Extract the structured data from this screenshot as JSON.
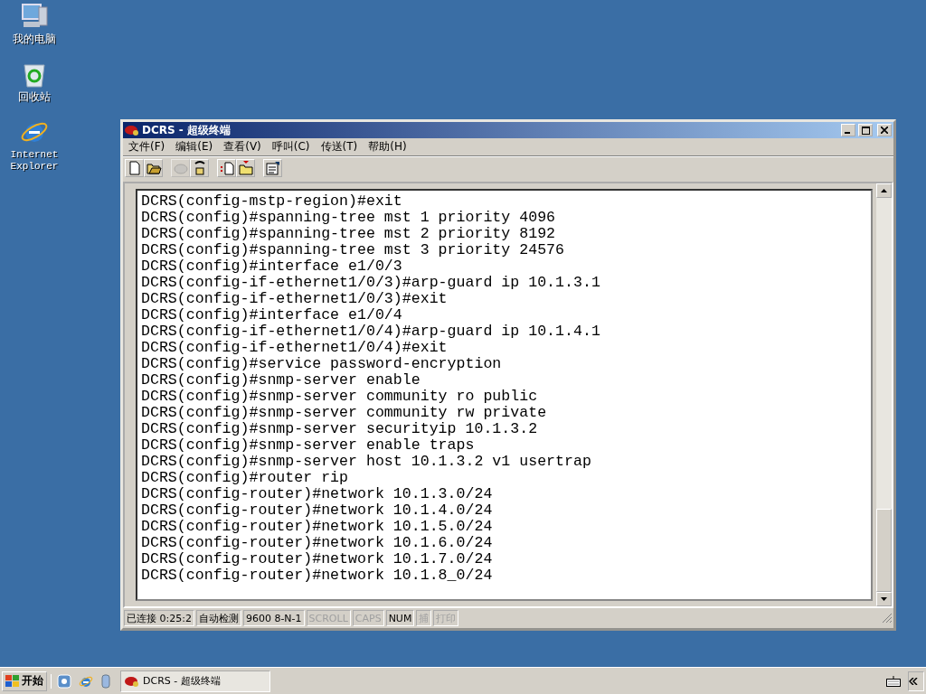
{
  "desktop_icons": [
    {
      "kind": "computer",
      "label": "我的电脑"
    },
    {
      "kind": "recycle",
      "label": "回收站"
    },
    {
      "kind": "browser",
      "label": "Internet Explorer"
    }
  ],
  "window": {
    "title": "DCRS - 超级终端",
    "active": true,
    "menu": [
      "文件(F)",
      "编辑(E)",
      "查看(V)",
      "呼叫(C)",
      "传送(T)",
      "帮助(H)"
    ],
    "toolbar": [
      {
        "kind": "new",
        "disabled": false
      },
      {
        "kind": "open",
        "disabled": false
      },
      {
        "kind": "call",
        "disabled": true
      },
      {
        "kind": "hangup",
        "disabled": false
      },
      {
        "kind": "send",
        "disabled": false
      },
      {
        "kind": "receive",
        "disabled": false
      },
      {
        "kind": "properties",
        "disabled": false
      }
    ],
    "terminal_lines": [
      "DCRS(config-mstp-region)#exit",
      "DCRS(config)#spanning-tree mst 1 priority 4096",
      "DCRS(config)#spanning-tree mst 2 priority 8192",
      "DCRS(config)#spanning-tree mst 3 priority 24576",
      "DCRS(config)#interface e1/0/3",
      "DCRS(config-if-ethernet1/0/3)#arp-guard ip 10.1.3.1",
      "DCRS(config-if-ethernet1/0/3)#exit",
      "DCRS(config)#interface e1/0/4",
      "DCRS(config-if-ethernet1/0/4)#arp-guard ip 10.1.4.1",
      "DCRS(config-if-ethernet1/0/4)#exit",
      "DCRS(config)#service password-encryption",
      "DCRS(config)#snmp-server enable",
      "DCRS(config)#snmp-server community ro public",
      "DCRS(config)#snmp-server community rw private",
      "DCRS(config)#snmp-server securityip 10.1.3.2",
      "DCRS(config)#snmp-server enable traps",
      "DCRS(config)#snmp-server host 10.1.3.2 v1 usertrap",
      "DCRS(config)#router rip",
      "DCRS(config-router)#network 10.1.3.0/24",
      "DCRS(config-router)#network 10.1.4.0/24",
      "DCRS(config-router)#network 10.1.5.0/24",
      "DCRS(config-router)#network 10.1.6.0/24",
      "DCRS(config-router)#network 10.1.7.0/24",
      "DCRS(config-router)#network 10.1.8_0/24"
    ],
    "status_bar": [
      {
        "text": "已连接 0:25:2",
        "on": true
      },
      {
        "text": "自动检测",
        "on": true
      },
      {
        "text": "9600 8-N-1",
        "on": true
      },
      {
        "text": "SCROLL",
        "on": false
      },
      {
        "text": "CAPS",
        "on": false
      },
      {
        "text": "NUM",
        "on": true
      },
      {
        "text": "捕",
        "on": false
      },
      {
        "text": "打印",
        "on": false
      }
    ]
  },
  "taskbar": {
    "start": "开始",
    "quick_launch": [
      {
        "kind": "desktop"
      },
      {
        "kind": "browser"
      },
      {
        "kind": "media"
      }
    ],
    "tasks": [
      {
        "label": "DCRS - 超级终端",
        "selected": true
      }
    ]
  }
}
